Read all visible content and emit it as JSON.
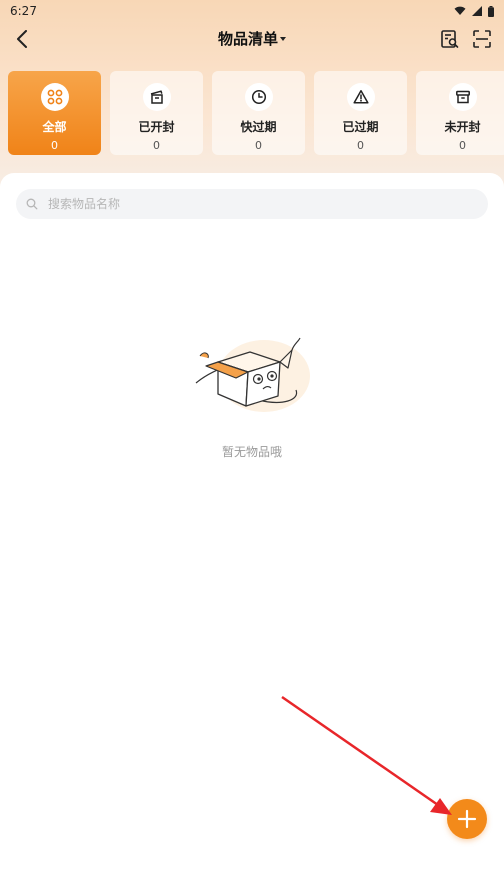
{
  "status_bar": {
    "time": "6:27"
  },
  "header": {
    "title": "物品清单"
  },
  "categories": [
    {
      "label": "全部",
      "count": "0",
      "active": true
    },
    {
      "label": "已开封",
      "count": "0"
    },
    {
      "label": "快过期",
      "count": "0"
    },
    {
      "label": "已过期",
      "count": "0"
    },
    {
      "label": "未开封",
      "count": "0"
    }
  ],
  "search": {
    "placeholder": "搜索物品名称",
    "value": ""
  },
  "empty_state": {
    "text": "暂无物品哦"
  },
  "colors": {
    "accent": "#f38a1a",
    "annotation_arrow": "#e8262a"
  }
}
